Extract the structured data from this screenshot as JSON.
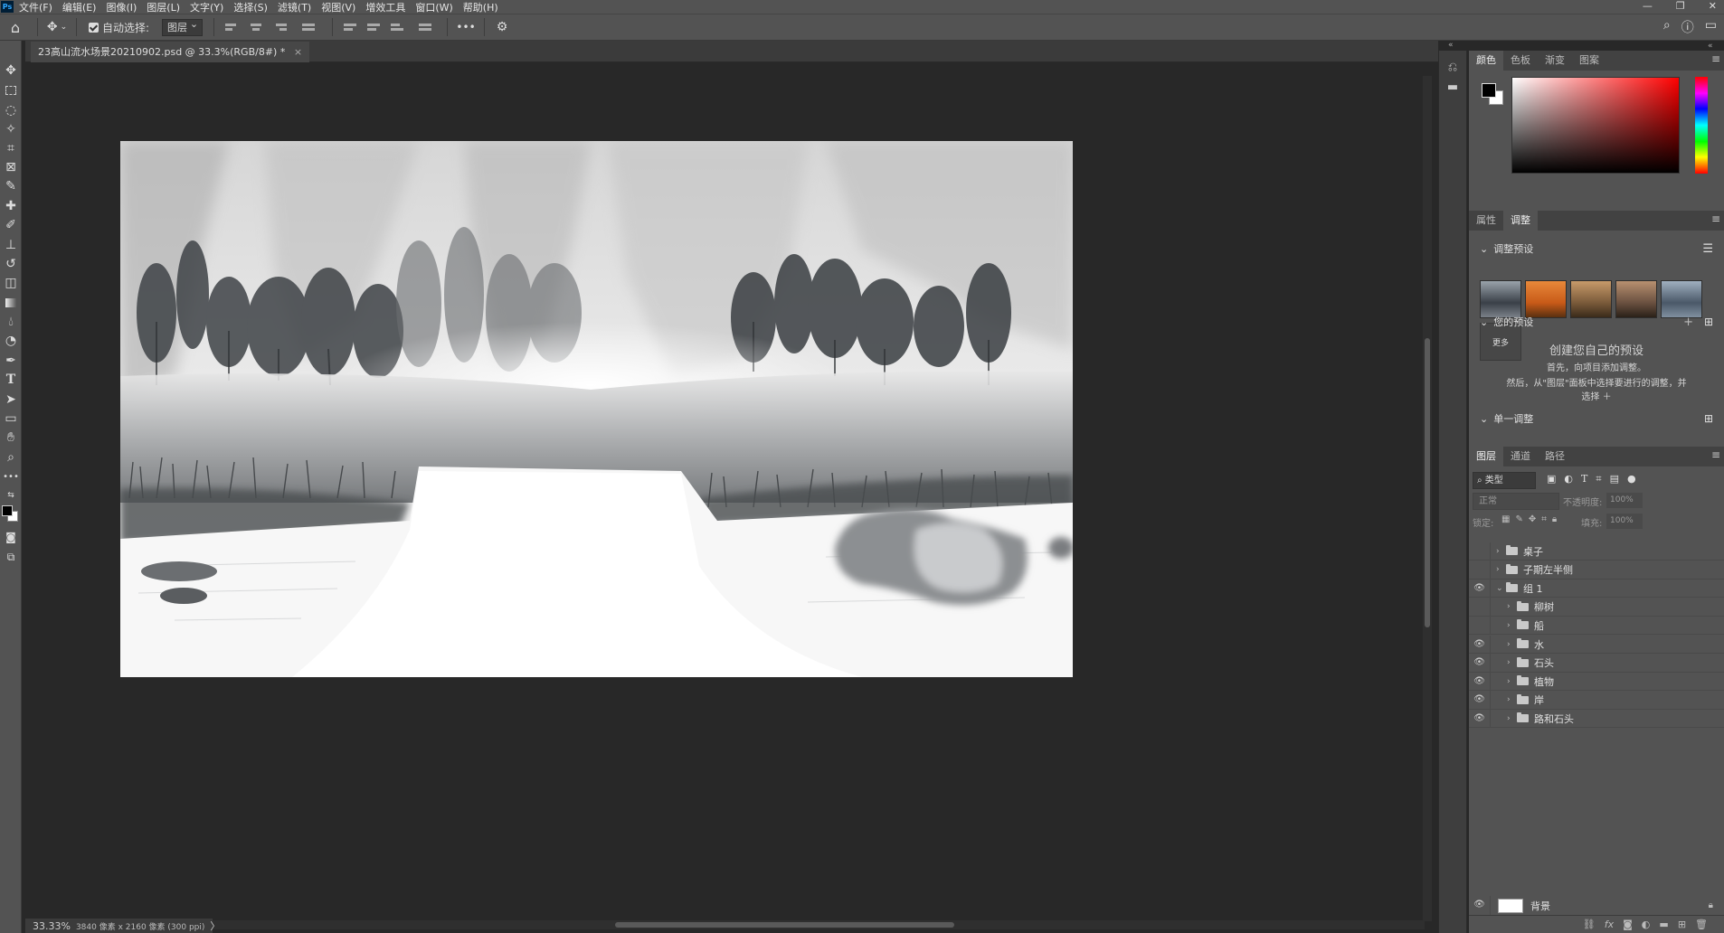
{
  "menu": {
    "app_icon": "Ps",
    "items": [
      "文件(F)",
      "编辑(E)",
      "图像(I)",
      "图层(L)",
      "文字(Y)",
      "选择(S)",
      "滤镜(T)",
      "视图(V)",
      "增效工具",
      "窗口(W)",
      "帮助(H)"
    ],
    "window_controls": [
      "—",
      "❐",
      "✕"
    ]
  },
  "options": {
    "auto_select_label": "自动选择:",
    "auto_select_value": "图层",
    "more_label": "•••"
  },
  "document": {
    "tab_title": "23高山流水场景20210902.psd @ 33.3%(RGB/8#) *",
    "tab_close": "×"
  },
  "status": {
    "zoom": "33.33%",
    "doc_info": "3840 像素 x 2160 像素 (300 ppi)",
    "arrow": "〉"
  },
  "color_panel": {
    "tabs": [
      "颜色",
      "色板",
      "渐变",
      "图案"
    ],
    "active_tab": "颜色",
    "fg_color": "#000000",
    "bg_color": "#ffffff"
  },
  "adjust_panel": {
    "tabs": [
      "属性",
      "调整"
    ],
    "active_tab": "调整",
    "presets_title": "调整预设",
    "more_label": "更多",
    "your_presets_title": "您的预设",
    "create_title": "创建您自己的预设",
    "create_line1": "首先，向项目添加调整。",
    "create_line2": "然后，从\"图层\"面板中选择要进行的调整，并",
    "create_line3": "选择 ＋",
    "single_adjust_title": "单一调整"
  },
  "layers_panel": {
    "tabs": [
      "图层",
      "通道",
      "路径"
    ],
    "active_tab": "图层",
    "filter_kind": "类型",
    "blend_mode": "正常",
    "opacity_label": "不透明度:",
    "opacity_value": "100%",
    "lock_label": "锁定:",
    "fill_label": "填充:",
    "fill_value": "100%",
    "layers": [
      {
        "name": "桌子",
        "visible": false,
        "indent": 0,
        "expanded": false
      },
      {
        "name": "子期左半侧",
        "visible": false,
        "indent": 0,
        "expanded": false
      },
      {
        "name": "组 1",
        "visible": true,
        "indent": 0,
        "expanded": true
      },
      {
        "name": "柳树",
        "visible": false,
        "indent": 1,
        "expanded": false
      },
      {
        "name": "船",
        "visible": false,
        "indent": 1,
        "expanded": false
      },
      {
        "name": "水",
        "visible": true,
        "indent": 1,
        "expanded": false
      },
      {
        "name": "石头",
        "visible": true,
        "indent": 1,
        "expanded": false
      },
      {
        "name": "植物",
        "visible": true,
        "indent": 1,
        "expanded": false
      },
      {
        "name": "岸",
        "visible": true,
        "indent": 1,
        "expanded": false
      },
      {
        "name": "路和石头",
        "visible": true,
        "indent": 1,
        "expanded": false
      }
    ],
    "background_layer": "背景"
  }
}
